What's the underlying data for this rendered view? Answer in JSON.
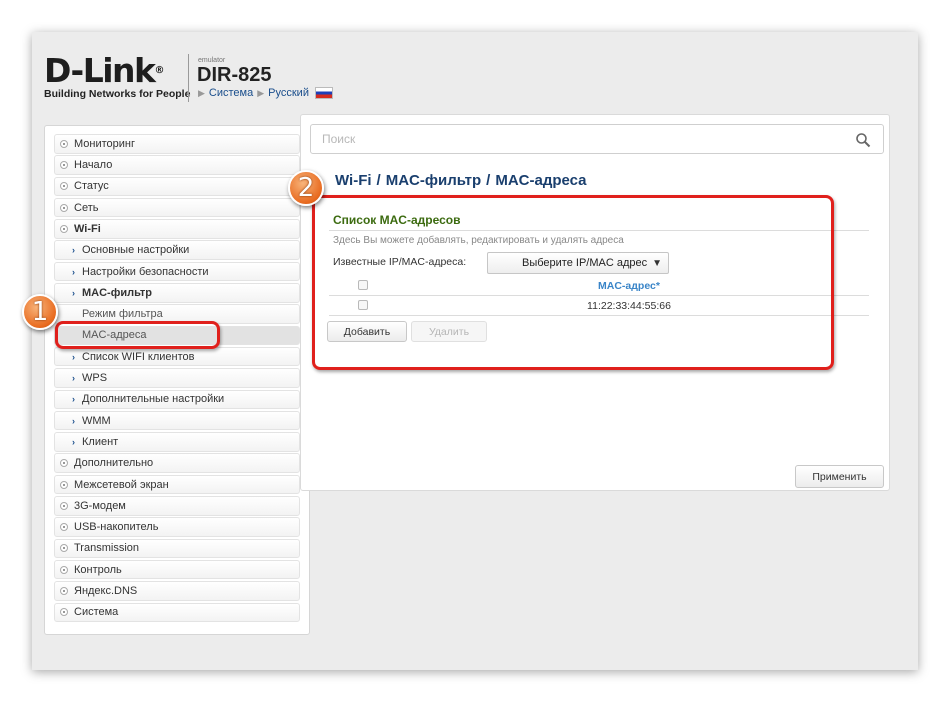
{
  "header": {
    "logo_text": "D-Link",
    "logo_tagline": "Building Networks for People",
    "emulator_label": "emulator",
    "model": "DIR-825",
    "links": [
      "Система",
      "Русский"
    ]
  },
  "sidebar": {
    "items": [
      {
        "label": "Мониторинг",
        "level": 0
      },
      {
        "label": "Начало",
        "level": 0
      },
      {
        "label": "Статус",
        "level": 0
      },
      {
        "label": "Сеть",
        "level": 0
      },
      {
        "label": "Wi-Fi",
        "level": 0,
        "expanded": true
      },
      {
        "label": "Основные настройки",
        "level": 1
      },
      {
        "label": "Настройки безопасности",
        "level": 1
      },
      {
        "label": "MAC-фильтр",
        "level": 1,
        "expanded": true
      },
      {
        "label": "Режим фильтра",
        "level": 2
      },
      {
        "label": "MAC-адреса",
        "level": 2,
        "selected": true
      },
      {
        "label": "Список WIFI клиентов",
        "level": 1
      },
      {
        "label": "WPS",
        "level": 1
      },
      {
        "label": "Дополнительные настройки",
        "level": 1
      },
      {
        "label": "WMM",
        "level": 1
      },
      {
        "label": "Клиент",
        "level": 1
      },
      {
        "label": "Дополнительно",
        "level": 0
      },
      {
        "label": "Межсетевой экран",
        "level": 0
      },
      {
        "label": "3G-модем",
        "level": 0
      },
      {
        "label": "USB-накопитель",
        "level": 0
      },
      {
        "label": "Transmission",
        "level": 0
      },
      {
        "label": "Контроль",
        "level": 0
      },
      {
        "label": "Яндекс.DNS",
        "level": 0
      },
      {
        "label": "Система",
        "level": 0
      }
    ]
  },
  "search": {
    "placeholder": "Поиск"
  },
  "breadcrumb": [
    "Wi-Fi",
    "MAC-фильтр",
    "MAC-адреса"
  ],
  "section": {
    "title": "Список MAC-адресов",
    "description": "Здесь Вы можете добавлять, редактировать и удалять адреса",
    "known_label": "Известные IP/MAC-адреса:",
    "select_value": "Выберите IP/MAC адрес"
  },
  "table": {
    "header": "MAC-адрес",
    "required_mark": "*",
    "rows": [
      "11:22:33:44:55:66"
    ]
  },
  "buttons": {
    "add": "Добавить",
    "delete": "Удалить",
    "apply": "Применить"
  },
  "annotations": {
    "badge1": "1",
    "badge2": "2",
    "color": "#e0201c"
  },
  "colors": {
    "accent": "#1a3f6e",
    "section_title": "#3c6b10",
    "table_header": "#3a85c8"
  }
}
